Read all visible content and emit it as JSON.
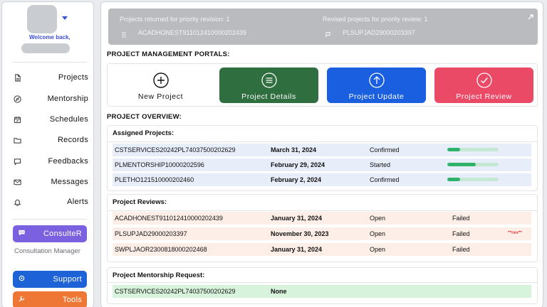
{
  "sidebar": {
    "welcome": "Welcome back,",
    "nav": [
      {
        "label": "Projects",
        "icon": "document-icon"
      },
      {
        "label": "Mentorship",
        "icon": "compass-icon"
      },
      {
        "label": "Schedules",
        "icon": "calendar-icon"
      },
      {
        "label": "Records",
        "icon": "folder-icon"
      },
      {
        "label": "Feedbacks",
        "icon": "chat-bubble-icon"
      },
      {
        "label": "Messages",
        "icon": "mail-icon"
      },
      {
        "label": "Alerts",
        "icon": "bell-icon"
      }
    ],
    "consulter": {
      "label": "ConsulteR",
      "color": "#7b61e0"
    },
    "consultation_manager": "Consultation Manager",
    "support": {
      "label": "Support",
      "color": "#1d62d6"
    },
    "tools": {
      "label": "Tools",
      "color": "#ee7736"
    }
  },
  "banner": {
    "left_title": "Projects returned for priority revision: 1",
    "left_value": "ACADHONEST911012410000202439",
    "right_title": "Revised projects for priority review: 1",
    "right_value": "PLSUPJAD29000203397"
  },
  "portals": {
    "title": "PROJECT MANAGEMENT PORTALS:",
    "items": [
      {
        "label": "New Project",
        "color": "#ffffff"
      },
      {
        "label": "Project Details",
        "color": "#2f6e3e"
      },
      {
        "label": "Project Update",
        "color": "#1a5fe0"
      },
      {
        "label": "Project Review",
        "color": "#eb4a67"
      }
    ]
  },
  "overview": {
    "title": "PROJECT OVERVIEW:",
    "assigned": {
      "title": "Assigned Projects:",
      "rows": [
        {
          "id": "CSTSERVICES20242PL74037500202629",
          "date": "March 31, 2024",
          "status": "Confirmed",
          "progress": 0.25
        },
        {
          "id": "PLMENTORSHIP10000202596",
          "date": "February 29, 2024",
          "status": "Started",
          "progress": 0.55
        },
        {
          "id": "PLETHO121510000202460",
          "date": "February 2, 2024",
          "status": "Confirmed",
          "progress": 0.25
        }
      ]
    },
    "reviews": {
      "title": "Project Reviews:",
      "rows": [
        {
          "id": "ACADHONEST911012410000202439",
          "date": "January 31, 2024",
          "status": "Open",
          "result": "Failed",
          "flag": ""
        },
        {
          "id": "PLSUPJAD29000203397",
          "date": "November 30, 2023",
          "status": "Open",
          "result": "Failed",
          "flag": "**rev**"
        },
        {
          "id": "SWPLJAOR2300818000202468",
          "date": "January 31, 2024",
          "status": "Open",
          "result": "Failed",
          "flag": ""
        }
      ]
    },
    "mentorship": {
      "title": "Project Mentorship Request:",
      "rows": [
        {
          "id": "CSTSERVICES20242PL74037500202629",
          "value": "None"
        }
      ]
    }
  }
}
